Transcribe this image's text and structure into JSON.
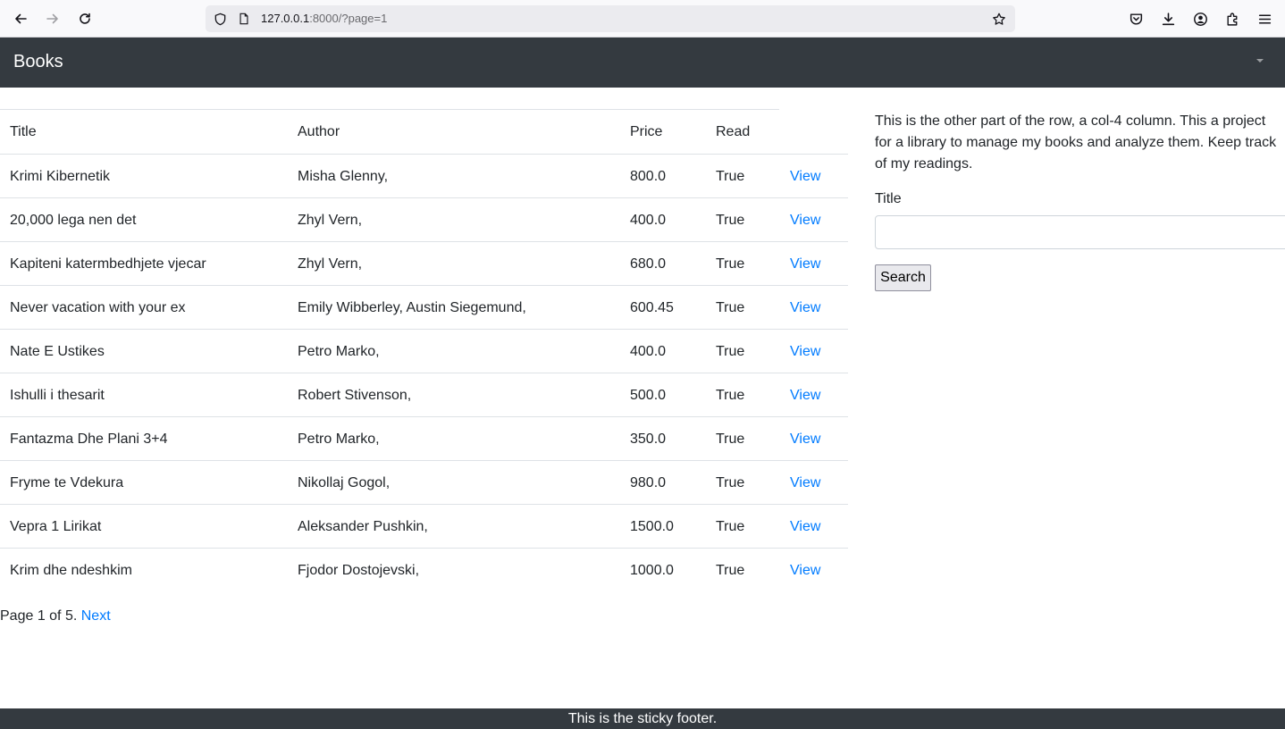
{
  "browser": {
    "url_host": "127.0.0.1",
    "url_rest": ":8000/?page=1"
  },
  "navbar": {
    "brand": "Books"
  },
  "table": {
    "headers": {
      "title": "Title",
      "author": "Author",
      "price": "Price",
      "read": "Read"
    },
    "rows": [
      {
        "title": "Krimi Kibernetik",
        "author": "Misha Glenny,",
        "price": "800.0",
        "read": "True",
        "view": "View"
      },
      {
        "title": "20,000 lega nen det",
        "author": "Zhyl Vern,",
        "price": "400.0",
        "read": "True",
        "view": "View"
      },
      {
        "title": "Kapiteni katermbedhjete vjecar",
        "author": "Zhyl Vern,",
        "price": "680.0",
        "read": "True",
        "view": "View"
      },
      {
        "title": "Never vacation with your ex",
        "author": "Emily Wibberley, Austin Siegemund,",
        "price": "600.45",
        "read": "True",
        "view": "View"
      },
      {
        "title": "Nate E Ustikes",
        "author": "Petro Marko,",
        "price": "400.0",
        "read": "True",
        "view": "View"
      },
      {
        "title": "Ishulli i thesarit",
        "author": "Robert Stivenson,",
        "price": "500.0",
        "read": "True",
        "view": "View"
      },
      {
        "title": "Fantazma Dhe Plani 3+4",
        "author": "Petro Marko,",
        "price": "350.0",
        "read": "True",
        "view": "View"
      },
      {
        "title": "Fryme te Vdekura",
        "author": "Nikollaj Gogol,",
        "price": "980.0",
        "read": "True",
        "view": "View"
      },
      {
        "title": "Vepra 1 Lirikat",
        "author": "Aleksander Pushkin,",
        "price": "1500.0",
        "read": "True",
        "view": "View"
      },
      {
        "title": "Krim dhe ndeshkim",
        "author": "Fjodor Dostojevski,",
        "price": "1000.0",
        "read": "True",
        "view": "View"
      }
    ]
  },
  "pagination": {
    "text": "Page 1 of 5.",
    "next_label": "Next"
  },
  "sidebar": {
    "description": "This is the other part of the row, a col-4 column. This a project for a library to manage my books and analyze them. Keep track of my readings.",
    "title_label": "Title",
    "title_value": "",
    "search_label": "Search"
  },
  "footer": {
    "text": "This is the sticky footer."
  }
}
